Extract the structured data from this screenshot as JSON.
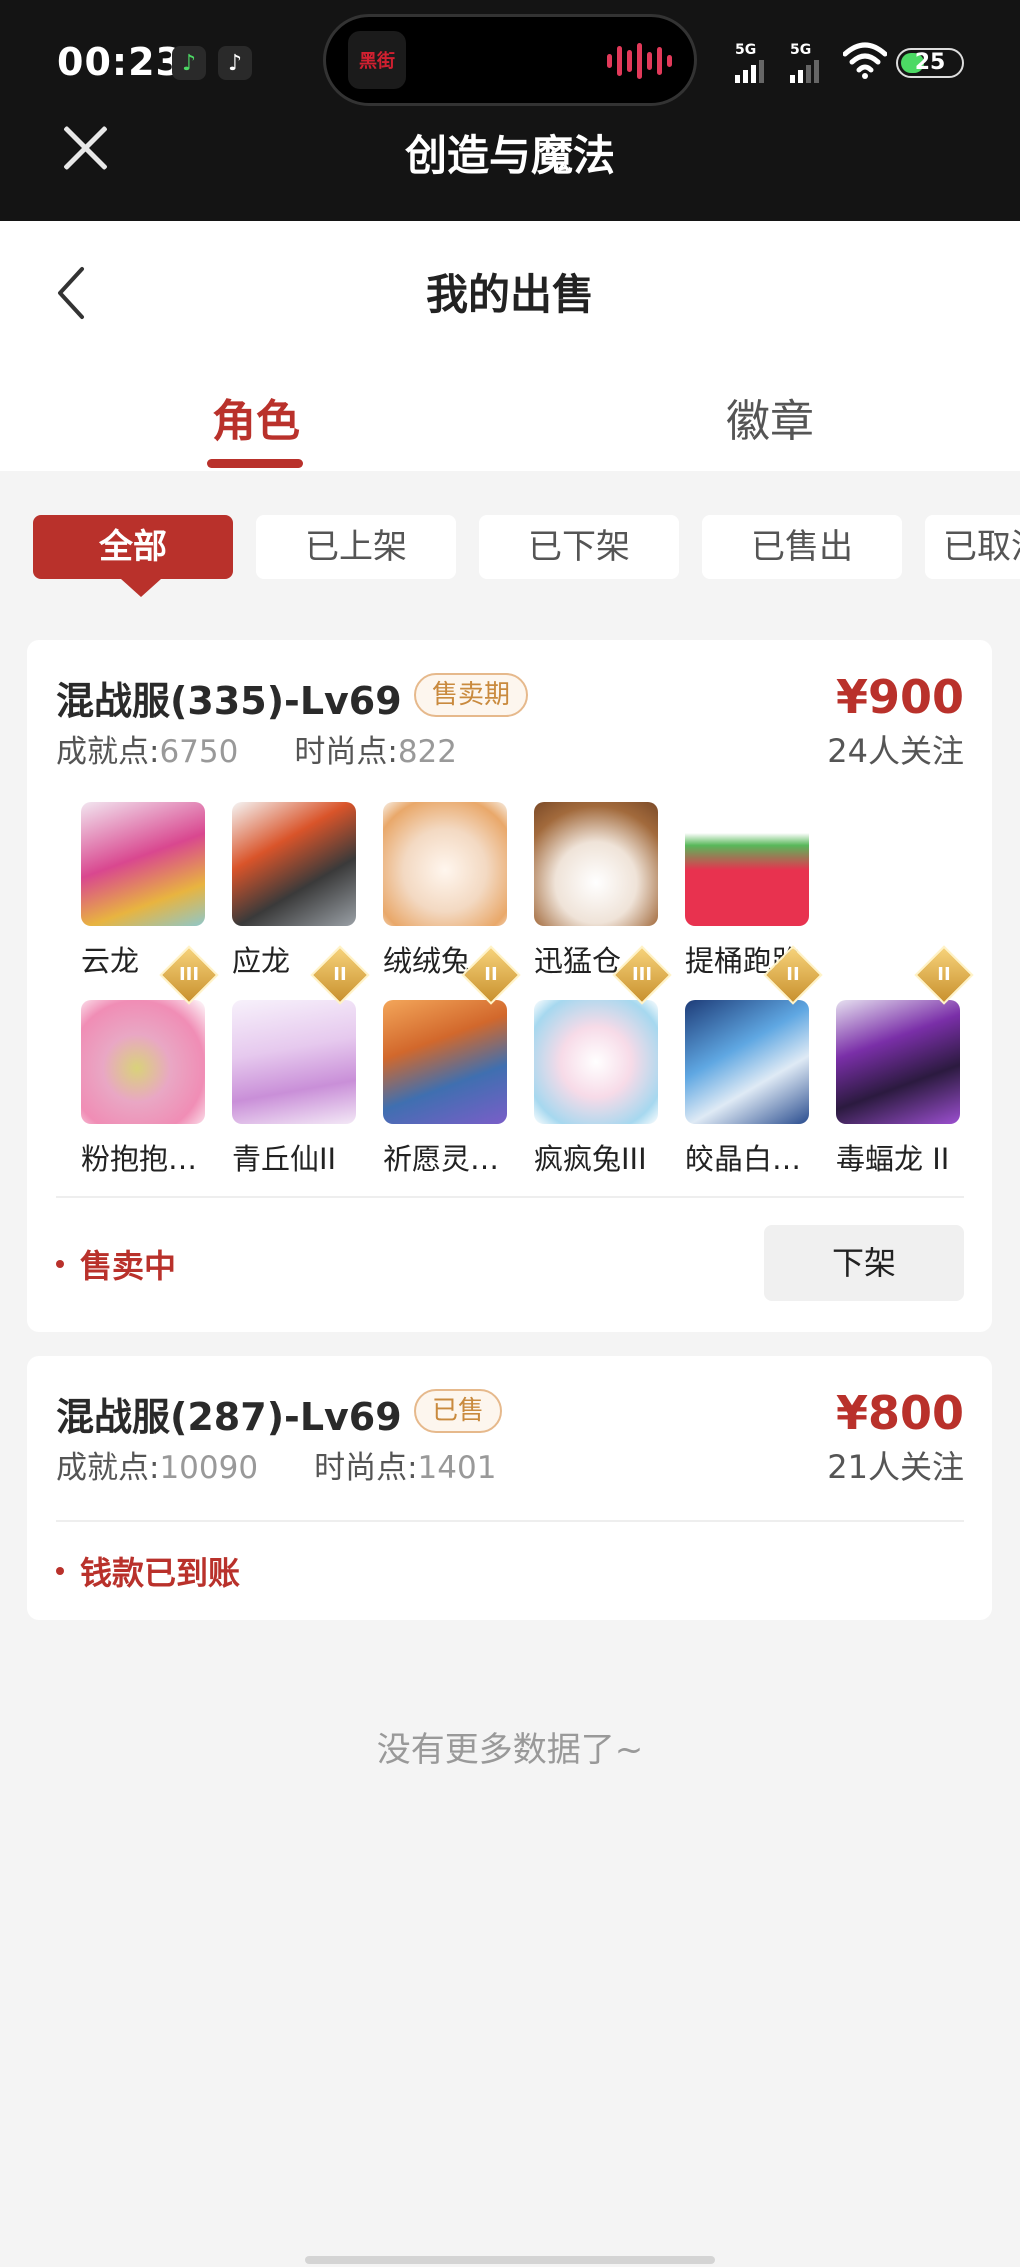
{
  "status_bar": {
    "time": "00:23",
    "island_label": "黑街",
    "signal_1": "5G",
    "signal_2": "5G",
    "battery": "25"
  },
  "miniapp": {
    "title": "创造与魔法"
  },
  "page": {
    "title": "我的出售",
    "tabs": [
      {
        "label": "角色"
      },
      {
        "label": "徽章"
      }
    ],
    "filters": [
      {
        "label": "全部"
      },
      {
        "label": "已上架"
      },
      {
        "label": "已下架"
      },
      {
        "label": "已售出"
      },
      {
        "label": "已取消"
      }
    ],
    "no_more": "没有更多数据了~"
  },
  "listings": [
    {
      "title": "混战服(335)-Lv69",
      "badge": "售卖期",
      "price": "¥900",
      "followers": "24人关注",
      "achievement_label": "成就点:",
      "achievement_value": "6750",
      "fashion_label": "时尚点:",
      "fashion_value": "822",
      "status": "售卖中",
      "action": "下架",
      "avatars": [
        {
          "name": "云龙",
          "rank": ""
        },
        {
          "name": "应龙",
          "rank": ""
        },
        {
          "name": "绒绒兔",
          "rank": ""
        },
        {
          "name": "迅猛仓…",
          "rank": ""
        },
        {
          "name": "提桶跑路",
          "rank": ""
        },
        {
          "name": "粉抱抱…",
          "rank": "III"
        },
        {
          "name": "青丘仙II",
          "rank": "II"
        },
        {
          "name": "祈愿灵…",
          "rank": "II"
        },
        {
          "name": "疯疯兔III",
          "rank": "III"
        },
        {
          "name": "皎晶白…",
          "rank": "II"
        },
        {
          "name": "毒蝠龙 II",
          "rank": "II"
        }
      ]
    },
    {
      "title": "混战服(287)-Lv69",
      "badge": "已售",
      "price": "¥800",
      "followers": "21人关注",
      "achievement_label": "成就点:",
      "achievement_value": "10090",
      "fashion_label": "时尚点:",
      "fashion_value": "1401",
      "status": "钱款已到账"
    }
  ],
  "colors": {
    "accent": "#b9312b",
    "badge_text": "#c98a3e",
    "header_bg": "#141414",
    "page_bg": "#f4f4f4"
  }
}
